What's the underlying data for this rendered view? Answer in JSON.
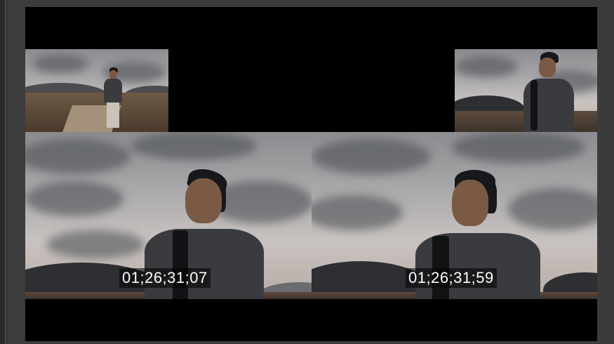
{
  "program_monitor": {
    "outgoing_timecode": "01;26;31;07",
    "incoming_timecode": "01;26;31;59"
  },
  "icons": {
    "outgoing_frame": "video-frame-icon",
    "incoming_frame": "video-frame-icon"
  }
}
